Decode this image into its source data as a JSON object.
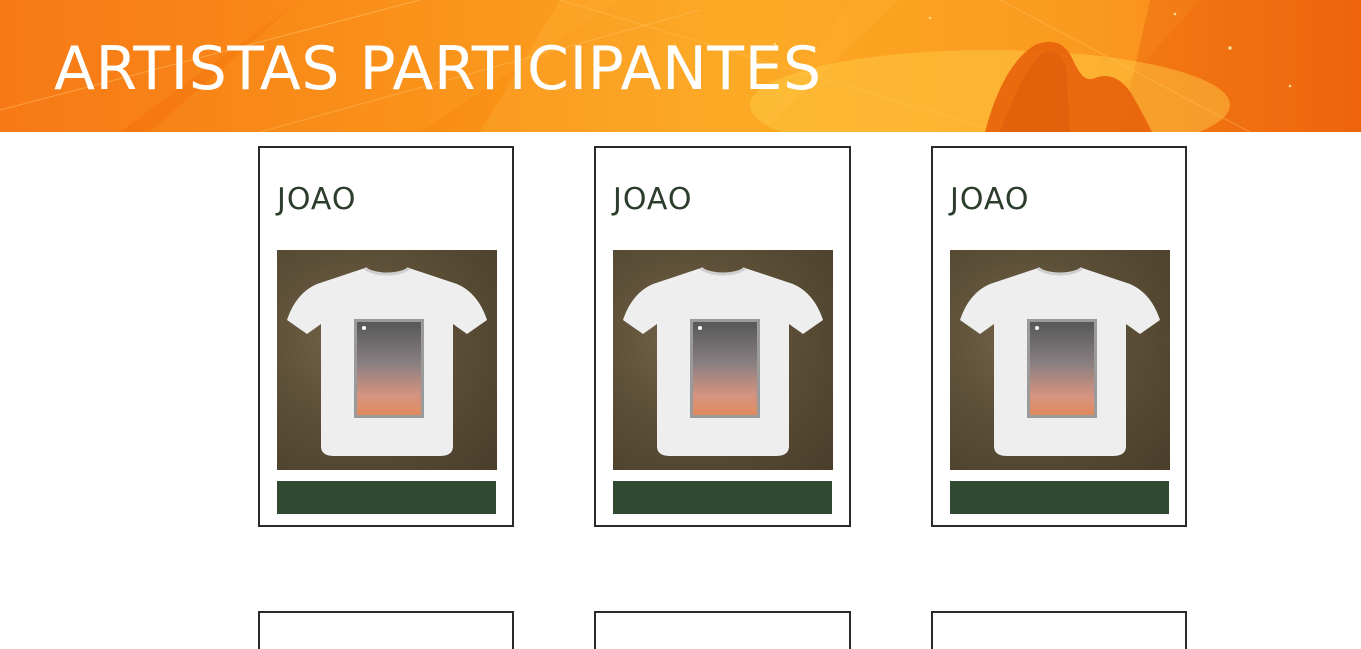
{
  "header": {
    "title": "ARTISTAS PARTICIPANTES",
    "background_color": "#f98b14"
  },
  "artists": [
    {
      "name": "JOAO",
      "image_icon": "tshirt-product-image"
    },
    {
      "name": "JOAO",
      "image_icon": "tshirt-product-image"
    },
    {
      "name": "JOAO",
      "image_icon": "tshirt-product-image"
    }
  ],
  "colors": {
    "accent": "#2f4a31",
    "card_border": "#2a2a2a",
    "name_text": "#2c3d2b"
  }
}
